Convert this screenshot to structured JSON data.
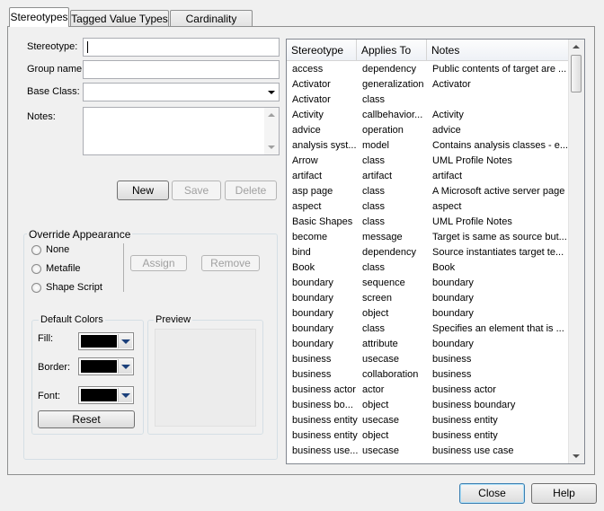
{
  "tabs": [
    {
      "label": "Stereotypes"
    },
    {
      "label": "Tagged Value Types"
    },
    {
      "label": "Cardinality Values"
    }
  ],
  "form": {
    "stereotype_label": "Stereotype:",
    "stereotype_value": "",
    "group_label": "Group name:",
    "group_value": "",
    "base_class_label": "Base Class:",
    "base_class_value": "",
    "notes_label": "Notes:",
    "notes_value": ""
  },
  "actions": {
    "new": "New",
    "save": "Save",
    "delete": "Delete"
  },
  "override": {
    "title": "Override Appearance",
    "options": [
      "None",
      "Metafile",
      "Shape Script"
    ],
    "assign": "Assign",
    "remove": "Remove"
  },
  "default_colors": {
    "title": "Default Colors",
    "fill_label": "Fill:",
    "border_label": "Border:",
    "font_label": "Font:",
    "fill_color": "#000000",
    "border_color": "#000000",
    "font_color": "#000000",
    "reset": "Reset"
  },
  "preview": {
    "title": "Preview"
  },
  "table": {
    "columns": [
      "Stereotype",
      "Applies To",
      "Notes"
    ],
    "rows": [
      [
        "access",
        "dependency",
        "Public contents of target are ..."
      ],
      [
        "Activator",
        "generalization",
        "Activator"
      ],
      [
        "Activator",
        "class",
        ""
      ],
      [
        "Activity",
        "callbehavior...",
        "Activity"
      ],
      [
        "advice",
        "operation",
        "advice"
      ],
      [
        "analysis syst...",
        "model",
        "Contains analysis classes - e..."
      ],
      [
        "Arrow",
        "class",
        "UML Profile Notes"
      ],
      [
        "artifact",
        "artifact",
        "artifact"
      ],
      [
        "asp page",
        "class",
        "A Microsoft active server page"
      ],
      [
        "aspect",
        "class",
        "aspect"
      ],
      [
        "Basic Shapes",
        "class",
        "UML Profile Notes"
      ],
      [
        "become",
        "message",
        "Target is same as source but..."
      ],
      [
        "bind",
        "dependency",
        "Source instantiates target te..."
      ],
      [
        "Book",
        "class",
        "Book"
      ],
      [
        "boundary",
        "sequence",
        "boundary"
      ],
      [
        "boundary",
        "screen",
        "boundary"
      ],
      [
        "boundary",
        "object",
        "boundary"
      ],
      [
        "boundary",
        "class",
        "Specifies an element that is ..."
      ],
      [
        "boundary",
        "attribute",
        "boundary"
      ],
      [
        "business",
        "usecase",
        "business"
      ],
      [
        "business",
        "collaboration",
        "business"
      ],
      [
        "business actor",
        "actor",
        "business actor"
      ],
      [
        "business bo...",
        "object",
        "business boundary"
      ],
      [
        "business entity",
        "usecase",
        "business entity"
      ],
      [
        "business entity",
        "object",
        "business entity"
      ],
      [
        "business use...",
        "usecase",
        "business use case"
      ]
    ]
  },
  "footer": {
    "close": "Close",
    "help": "Help"
  }
}
